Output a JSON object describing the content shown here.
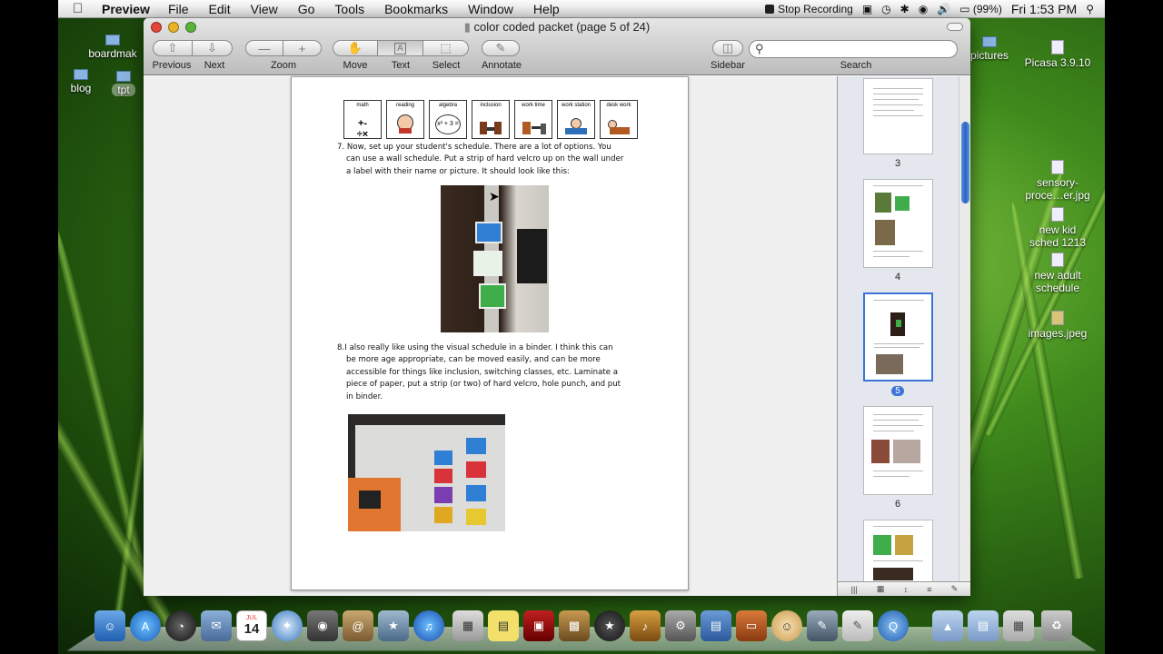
{
  "menubar": {
    "app_name": "Preview",
    "menus": [
      "File",
      "Edit",
      "View",
      "Go",
      "Tools",
      "Bookmarks",
      "Window",
      "Help"
    ],
    "stop_recording": "Stop Recording",
    "battery": "(99%)",
    "clock": "Fri 1:53 PM"
  },
  "desktop": {
    "left_icons": [
      "boardmak",
      "blog",
      "tpt"
    ],
    "right_icons": [
      "pictures",
      "Picasa 3.9.10",
      "sensory-\nproce…er.jpg",
      "new kid\nsched   1213",
      "new adult\nschedule",
      "images.jpeg"
    ]
  },
  "window": {
    "title": "color coded packet (page 5 of 24)",
    "toolbar": {
      "previous": "Previous",
      "next": "Next",
      "zoom": "Zoom",
      "move": "Move",
      "text": "Text",
      "select": "Select",
      "annotate": "Annotate",
      "sidebar": "Sidebar",
      "search": "Search"
    }
  },
  "page": {
    "symbols": [
      "math",
      "reading",
      "algebra",
      "inclusion",
      "work time",
      "work station",
      "desk work"
    ],
    "algebra_expr": "x² + 3 =",
    "step7": [
      "7.  Now, set up your student's schedule. There are a lot of options. You",
      "can use a wall schedule. Put a strip of hard velcro up on the wall under",
      "a label with their name or picture. It should look like this:"
    ],
    "step8": [
      "8.I also really like using the visual schedule in a binder. I think this can",
      "be more age appropriate, can be moved easily, and can be more",
      "accessible for things like inclusion, switching classes, etc. Laminate a",
      "piece of paper, put a strip (or two) of hard velcro, hole punch, and put",
      "in binder."
    ]
  },
  "sidebar": {
    "page_numbers": [
      "3",
      "4",
      "5",
      "6"
    ],
    "selected_page": "5"
  },
  "dock": {
    "calendar_day": "14",
    "calendar_month": "JUL"
  }
}
